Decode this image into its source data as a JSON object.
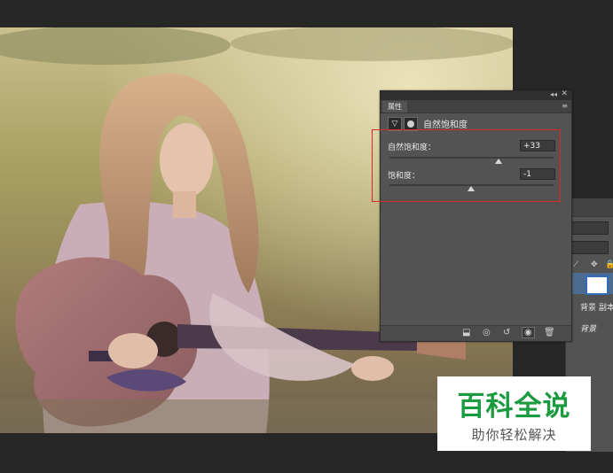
{
  "properties_panel": {
    "tab_label": "属性",
    "collapse_glyph": "◂◂",
    "close_glyph": "✕",
    "menu_glyph": "≡",
    "adjustment_title": "自然饱和度",
    "vibrance": {
      "label": "自然饱和度：",
      "value": "+33",
      "level": 33,
      "min": -100,
      "max": 100
    },
    "saturation": {
      "label": "饱和度：",
      "value": "-1",
      "level": -1,
      "min": -100,
      "max": 100
    },
    "footer_icons": [
      "clip-to-layer-icon",
      "view-previous-state-icon",
      "reset-icon",
      "visibility-eye-icon",
      "trash-icon"
    ]
  },
  "layers_panel": {
    "layers": [
      {
        "name": "背景 副本"
      },
      {
        "name": "背景"
      }
    ]
  },
  "watermark": {
    "title": "百科全说",
    "subtitle": "助你轻松解决"
  }
}
